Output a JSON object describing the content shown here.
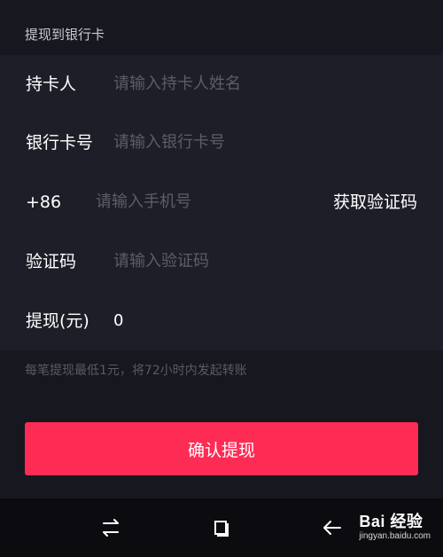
{
  "section_title": "提现到银行卡",
  "form": {
    "cardholder": {
      "label": "持卡人",
      "placeholder": "请输入持卡人姓名"
    },
    "card_number": {
      "label": "银行卡号",
      "placeholder": "请输入银行卡号"
    },
    "phone": {
      "prefix": "+86",
      "placeholder": "请输入手机号",
      "get_code_label": "获取验证码"
    },
    "code": {
      "label": "验证码",
      "placeholder": "请输入验证码"
    },
    "amount": {
      "label": "提现(元)",
      "value": "0"
    }
  },
  "hint": "每笔提现最低1元，将72小时内发起转账",
  "confirm_label": "确认提现",
  "colors": {
    "accent": "#fe2c55",
    "background": "#17171f",
    "panel": "#1e1e28"
  },
  "navbar": {
    "icons": [
      "switch-arrows-icon",
      "square-icon",
      "back-arrow-icon"
    ]
  },
  "watermark": {
    "text": "Bai 经验",
    "url": "jingyan.baidu.com"
  }
}
